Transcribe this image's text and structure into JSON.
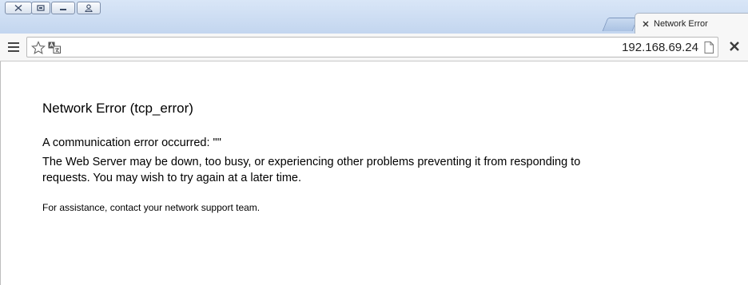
{
  "window": {
    "buttons": [
      "close",
      "restore",
      "minimize",
      "profile"
    ]
  },
  "tabs": [
    {
      "label": "Network Error",
      "active": true
    }
  ],
  "omnibox": {
    "url": "192.168.69.24"
  },
  "page": {
    "heading": "Network Error (tcp_error)",
    "message": "A communication error occurred: \"\"",
    "description": "The Web Server may be down, too busy, or experiencing other problems preventing it from responding to requests. You may wish to try again at a later time.",
    "assistance": "For assistance, contact your network support team."
  },
  "colors": {
    "titlebar": "#c3d6ef",
    "toolbar": "#f7f7f7",
    "text": "#000000"
  }
}
